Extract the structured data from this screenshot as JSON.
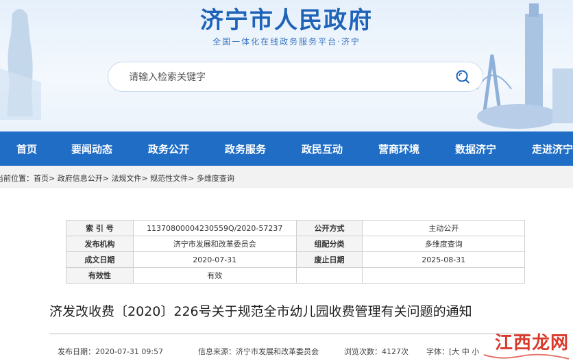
{
  "header": {
    "title": "济宁市人民政府",
    "subtitle": "全国一体化在线政务服务平台·济宁",
    "search_placeholder": "请输入检索关键字"
  },
  "nav": {
    "items": [
      "首页",
      "要闻动态",
      "政务公开",
      "政务服务",
      "政民互动",
      "营商环境",
      "数据济宁",
      "走进济宁"
    ]
  },
  "breadcrumb": {
    "prefix": "当前位置：",
    "items": [
      "首页",
      "政府信息公开",
      "法规文件",
      "规范性文件",
      "多维度查询"
    ],
    "sep": ">"
  },
  "info": {
    "index_label": "索 引 号",
    "index_value": "11370800004230559Q/2020-57237",
    "open_label": "公开方式",
    "open_value": "主动公开",
    "org_label": "发布机构",
    "org_value": "济宁市发展和改革委员会",
    "group_label": "组配分类",
    "group_value": "多维度查询",
    "made_label": "成文日期",
    "made_value": "2020-07-31",
    "expire_label": "废止日期",
    "expire_value": "2025-08-31",
    "valid_label": "有效性",
    "valid_value": "有效"
  },
  "document": {
    "title": "济发改收费〔2020〕226号关于规范全市幼儿园收费管理有关问题的通知"
  },
  "meta": {
    "date": "发布日期：2020-07-31 09:57",
    "source": "信息来源：济宁市发展和改革委员会",
    "views": "浏览次数：4127次",
    "font_label": "字体：[",
    "font_large": "大",
    "font_mid": "中",
    "font_small": "小"
  },
  "watermark": {
    "text": "江西龙网"
  },
  "colors": {
    "brand": "#1f6dc5",
    "title": "#1e63b8",
    "watermark": "#d93a2b"
  }
}
